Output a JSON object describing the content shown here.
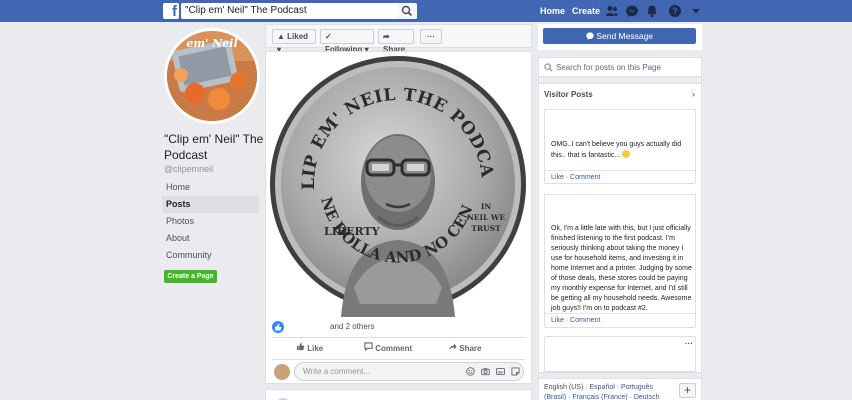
{
  "topbar": {
    "logo": "f",
    "search_value": "\"Clip em' Neil\" The Podcast",
    "nav": [
      "Home",
      "Create"
    ],
    "icons": [
      "friends-icon",
      "messenger-icon",
      "notifications-icon",
      "help-icon",
      "caret-down-icon"
    ]
  },
  "profile": {
    "name": "\"Clip em' Neil\" The Podcast",
    "username": "@clipemneil",
    "nav": [
      "Home",
      "Posts",
      "Photos",
      "About",
      "Community"
    ],
    "active_nav": "Posts",
    "create_page_label": "Create a Page"
  },
  "action_bar": {
    "liked": "Liked",
    "following": "Following",
    "share": "Share",
    "more": "···"
  },
  "post": {
    "coin": {
      "top_text": "CLIP EM' NEIL THE PODCAST",
      "left_text": "LIBERTY",
      "right_text_1": "IN",
      "right_text_2": "NEIL WE",
      "right_text_3": "TRUST",
      "bottom_text": "ONE DOLLA AND NO CENTS"
    },
    "reactions_text": "and 2 others",
    "actions": [
      "Like",
      "Comment",
      "Share"
    ],
    "comment_placeholder": "Write a comment..."
  },
  "right": {
    "send_message": "Send Message",
    "search_placeholder": "Search for posts on this Page",
    "visitor_posts_title": "Visitor Posts",
    "visitor_posts": [
      {
        "text": "OMG..I can't believe you guys actually did this.. that is fantastic...",
        "links": "Like · Comment"
      },
      {
        "text": "Ok, I'm a little late with this, but I just officially finished listening to the first podcast. I'm seriously thinking about taking the money I use for household items, and investing it in home Internet and a printer. Judging by some of those deals, these stores could be paying my monthly expense for Internet, and I'd still be getting all my household needs. Awesome job guys!! I'm on to podcast #2.",
        "links": "Like · Comment"
      },
      {
        "more": "···"
      }
    ],
    "languages": {
      "current": "English (US) · ",
      "others": "Español · Português (Brasil) · Français (France) · Deutsch"
    },
    "lang_plus": "+"
  },
  "colors": {
    "brand": "#4267b2",
    "background": "#e9ebee",
    "green": "#42b72a",
    "link": "#385898"
  }
}
